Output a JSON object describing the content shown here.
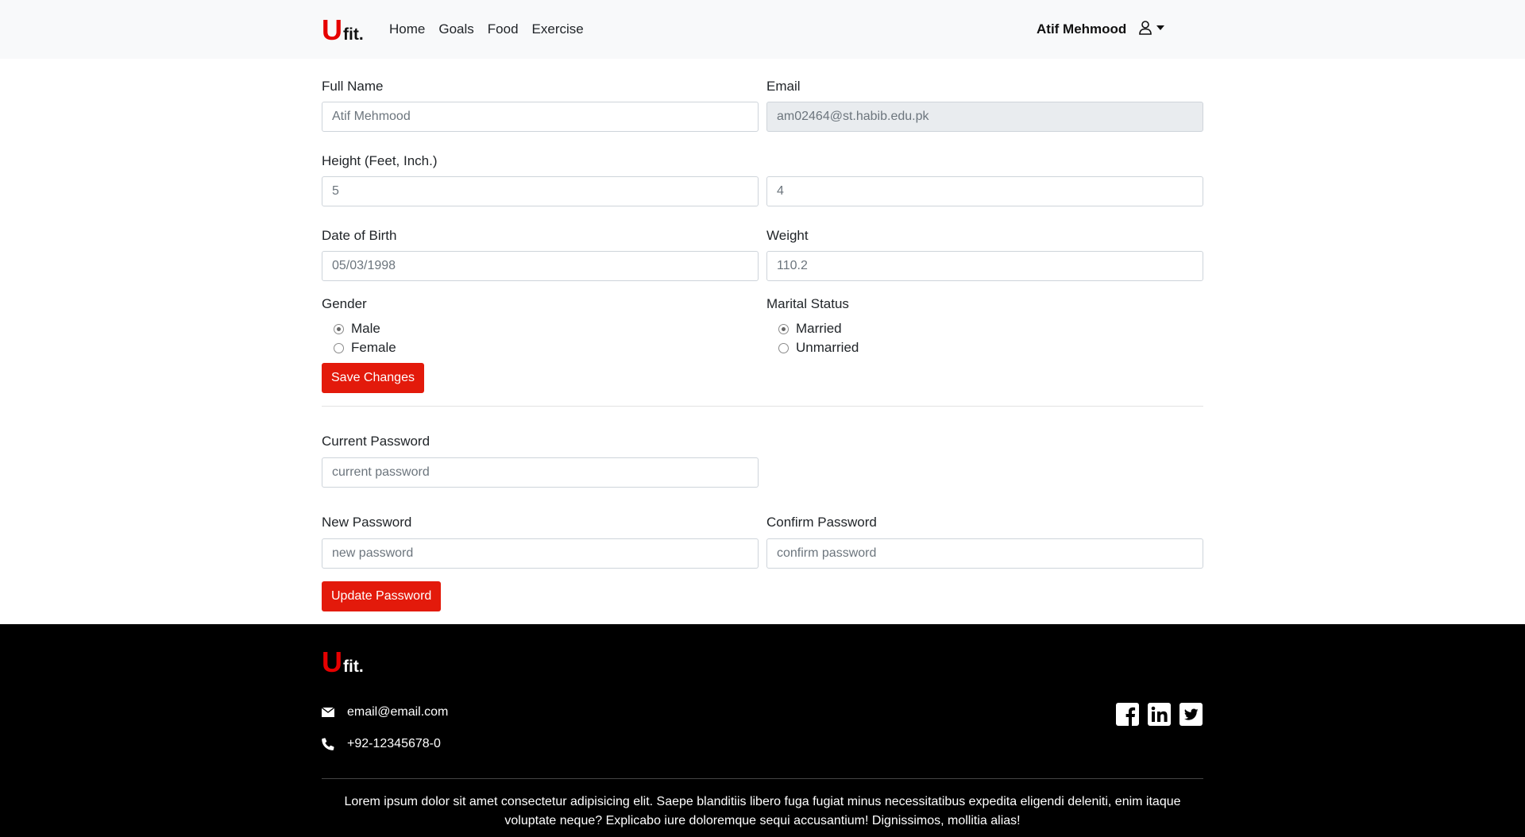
{
  "brand": {
    "u": "U",
    "fit": "fit."
  },
  "nav": {
    "home": "Home",
    "goals": "Goals",
    "food": "Food",
    "exercise": "Exercise"
  },
  "user": {
    "name": "Atif Mehmood"
  },
  "profile": {
    "full_name_label": "Full Name",
    "full_name_value": "Atif Mehmood",
    "email_label": "Email",
    "email_value": "am02464@st.habib.edu.pk",
    "height_label": "Height (Feet, Inch.)",
    "height_feet": "5",
    "height_inch": "4",
    "dob_label": "Date of Birth",
    "dob_value": "05/03/1998",
    "weight_label": "Weight",
    "weight_value": "110.2",
    "gender_label": "Gender",
    "gender_options": [
      "Male",
      "Female"
    ],
    "gender_selected": "Male",
    "marital_label": "Marital Status",
    "marital_options": [
      "Married",
      "Unmarried"
    ],
    "marital_selected": "Married",
    "save_button": "Save Changes"
  },
  "password": {
    "current_label": "Current Password",
    "current_placeholder": "current password",
    "new_label": "New Password",
    "new_placeholder": "new password",
    "confirm_label": "Confirm Password",
    "confirm_placeholder": "confirm password",
    "update_button": "Update Password"
  },
  "footer": {
    "email": "email@email.com",
    "phone": "+92-12345678-0",
    "socials": [
      "facebook-icon",
      "linkedin-icon",
      "twitter-icon"
    ],
    "text": "Lorem ipsum dolor sit amet consectetur adipisicing elit. Saepe blanditiis libero fuga fugiat minus necessitatibus expedita eligendi deleniti, enim itaque voluptate neque? Explicabo iure doloremque sequi accusantium! Dignissimos, mollitia alias!"
  },
  "colors": {
    "accent": "#e31a0b",
    "brand_red": "#e60000",
    "navbar_bg": "#f8f9fa",
    "footer_bg": "#000000"
  }
}
